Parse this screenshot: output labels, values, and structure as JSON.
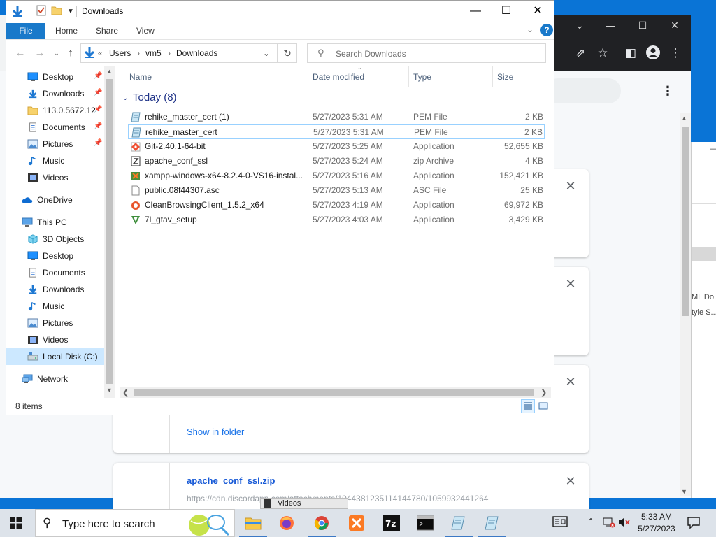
{
  "chrome": {
    "cards": [
      {
        "link": "",
        "url": ""
      },
      {
        "link": "",
        "url": ""
      },
      {
        "link": "Show in folder",
        "url": ""
      },
      {
        "link": "apache_conf_ssl.zip",
        "url": "https://cdn.discordapp.com/attachments/1044381235114144780/1059932441264"
      }
    ],
    "side_text": [
      "ML Do...",
      "tyle S..."
    ]
  },
  "explorer": {
    "title": "Downloads",
    "ribbon_tabs": [
      "File",
      "Home",
      "Share",
      "View"
    ],
    "address": {
      "prefix": "«",
      "crumbs": [
        "Users",
        "vm5",
        "Downloads"
      ]
    },
    "search_placeholder": "Search Downloads",
    "nav_items": [
      {
        "label": "Desktop",
        "icon": "desktop-icon",
        "pinned": true
      },
      {
        "label": "Downloads",
        "icon": "downloads-icon",
        "pinned": true
      },
      {
        "label": "113.0.5672.12",
        "icon": "folder-icon",
        "pinned": true
      },
      {
        "label": "Documents",
        "icon": "documents-icon",
        "pinned": true
      },
      {
        "label": "Pictures",
        "icon": "pictures-icon",
        "pinned": true
      },
      {
        "label": "Music",
        "icon": "music-icon",
        "pinned": false
      },
      {
        "label": "Videos",
        "icon": "videos-icon",
        "pinned": false
      },
      {
        "label": "OneDrive",
        "icon": "onedrive-icon",
        "pinned": false
      },
      {
        "label": "This PC",
        "icon": "this-pc-icon",
        "pinned": false
      },
      {
        "label": "3D Objects",
        "icon": "3d-objects-icon",
        "pinned": false
      },
      {
        "label": "Desktop",
        "icon": "desktop-icon",
        "pinned": false
      },
      {
        "label": "Documents",
        "icon": "documents-icon",
        "pinned": false
      },
      {
        "label": "Downloads",
        "icon": "downloads-icon",
        "pinned": false
      },
      {
        "label": "Music",
        "icon": "music-icon",
        "pinned": false
      },
      {
        "label": "Pictures",
        "icon": "pictures-icon",
        "pinned": false
      },
      {
        "label": "Videos",
        "icon": "videos-icon",
        "pinned": false
      },
      {
        "label": "Local Disk (C:)",
        "icon": "drive-icon",
        "pinned": false
      },
      {
        "label": "Network",
        "icon": "network-icon",
        "pinned": false
      }
    ],
    "columns": [
      "Name",
      "Date modified",
      "Type",
      "Size"
    ],
    "group_label": "Today (8)",
    "files": [
      {
        "name": "rehike_master_cert (1)",
        "date": "5/27/2023 5:31 AM",
        "type": "PEM File",
        "size": "2 KB",
        "icon": "certificate-file-icon"
      },
      {
        "name": "rehike_master_cert",
        "date": "5/27/2023 5:31 AM",
        "type": "PEM File",
        "size": "2 KB",
        "icon": "certificate-file-icon"
      },
      {
        "name": "Git-2.40.1-64-bit",
        "date": "5/27/2023 5:25 AM",
        "type": "Application",
        "size": "52,655 KB",
        "icon": "git-installer-icon"
      },
      {
        "name": "apache_conf_ssl",
        "date": "5/27/2023 5:24 AM",
        "type": "zip Archive",
        "size": "4 KB",
        "icon": "zip-archive-icon"
      },
      {
        "name": "xampp-windows-x64-8.2.4-0-VS16-instal...",
        "date": "5/27/2023 5:16 AM",
        "type": "Application",
        "size": "152,421 KB",
        "icon": "xampp-installer-icon"
      },
      {
        "name": "public.08f44307.asc",
        "date": "5/27/2023 5:13 AM",
        "type": "ASC File",
        "size": "25 KB",
        "icon": "text-file-icon"
      },
      {
        "name": "CleanBrowsingClient_1.5.2_x64",
        "date": "5/27/2023 4:19 AM",
        "type": "Application",
        "size": "69,972 KB",
        "icon": "cleanbrowsing-icon"
      },
      {
        "name": "7l_gtav_setup",
        "date": "5/27/2023 4:03 AM",
        "type": "Application",
        "size": "3,429 KB",
        "icon": "gtav-setup-icon"
      }
    ],
    "status_count": "8 items"
  },
  "taskbar": {
    "search_placeholder": "Type here to search",
    "peek_label": "Videos",
    "time": "5:33 AM",
    "date": "5/27/2023"
  },
  "colors": {
    "desktop": "#0a74d6",
    "file_tab": "#1979ca",
    "selected_nav": "#cce8ff",
    "link": "#1a73e8",
    "chrome_dark": "#202124"
  }
}
